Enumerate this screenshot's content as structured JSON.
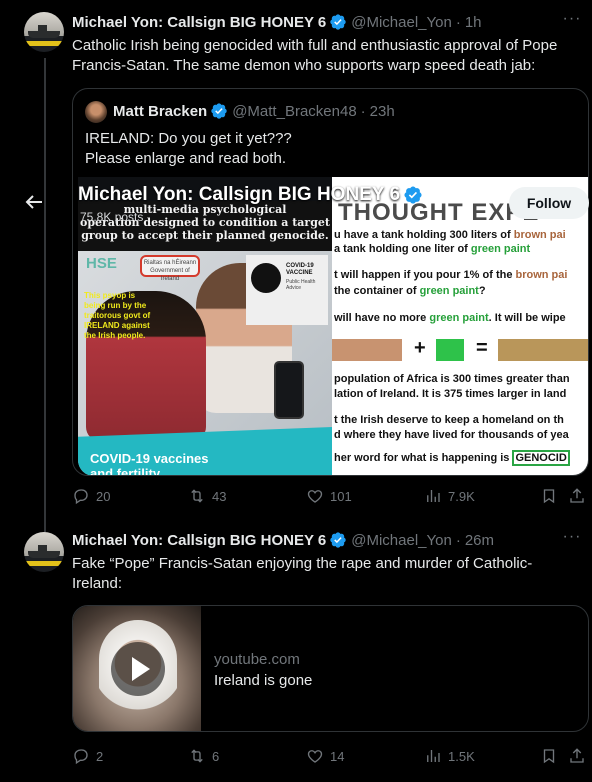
{
  "tweet1": {
    "name": "Michael Yon: Callsign BIG HONEY 6",
    "handle": "@Michael_Yon",
    "time": "1h",
    "text": "Catholic Irish being genocided with full and enthusiastic approval of Pope\nFrancis-Satan.  The same demon who supports warp speed death jab:",
    "more": "···",
    "stats": {
      "replies": "20",
      "reposts": "43",
      "likes": "101",
      "views": "7.9K"
    }
  },
  "quote": {
    "name": "Matt Bracken",
    "handle": "@Matt_Bracken48",
    "time": "23h",
    "text": "IRELAND: Do you get it yet???\nPlease enlarge and read both.",
    "image_left": {
      "headline": "multi-media psychological\noperation designed to condition a target\ngroup to accept their planned genocide.",
      "hse": "HSE",
      "govt": "Rialtas na hÉireann\nGovernment of Ireland",
      "psyop": "This psyop is\nbeing run by the\ntraitorous govt of\nIRELAND against\nthe Irish people.",
      "covid_box_label": "COVID-19\nVACCINE",
      "covid_box_sub": "Public Health\nAdvice",
      "covid_caption": "COVID-19 vaccines\nand fertility"
    },
    "image_right": {
      "heading": "THOUGHT EXPE",
      "line1_a": "u have a tank holding 300 liters of ",
      "line1_b": "brown pai",
      "line2_a": "a tank holding one liter of ",
      "line2_b": "green paint",
      "line3_a": "t will happen if you pour 1% of the ",
      "line3_b": "brown pai",
      "line4_a": "the container of ",
      "line4_b": "green paint",
      "line4_c": "?",
      "line5_a": "will have no more ",
      "line5_b": "green paint",
      "line5_c": ". It will be wipe",
      "plus": "+",
      "equals": "=",
      "line6": "population of Africa is 300 times greater than",
      "line7": "lation of Ireland. It is 375 times larger in land",
      "line8": "t the Irish deserve to keep a homeland on th",
      "line9": "d where they have lived for thousands of yea",
      "line10_a": "her word for what is happening is ",
      "line10_b": "GENOCID"
    }
  },
  "overlay": {
    "name": "Michael Yon: Callsign BIG HONEY 6",
    "posts": "75.8K posts",
    "follow_label": "Follow"
  },
  "tweet2": {
    "name": "Michael Yon: Callsign BIG HONEY 6",
    "handle": "@Michael_Yon",
    "time": "26m",
    "text": "Fake “Pope” Francis-Satan enjoying the rape and murder of Catholic-\nIreland:",
    "more": "···",
    "card": {
      "domain": "youtube.com",
      "title": "Ireland is gone"
    },
    "stats": {
      "replies": "2",
      "reposts": "6",
      "likes": "14",
      "views": "1.5K"
    }
  },
  "colors": {
    "background": "#000000",
    "text": "#e7e9ea",
    "secondary": "#71767b",
    "border": "#2f3336",
    "verified": "#1d9bf0"
  },
  "icons": [
    "arrow-left-icon",
    "verified-badge-icon",
    "reply-icon",
    "repost-icon",
    "like-icon",
    "views-icon",
    "bookmark-icon",
    "share-icon",
    "play-icon",
    "more-icon"
  ]
}
